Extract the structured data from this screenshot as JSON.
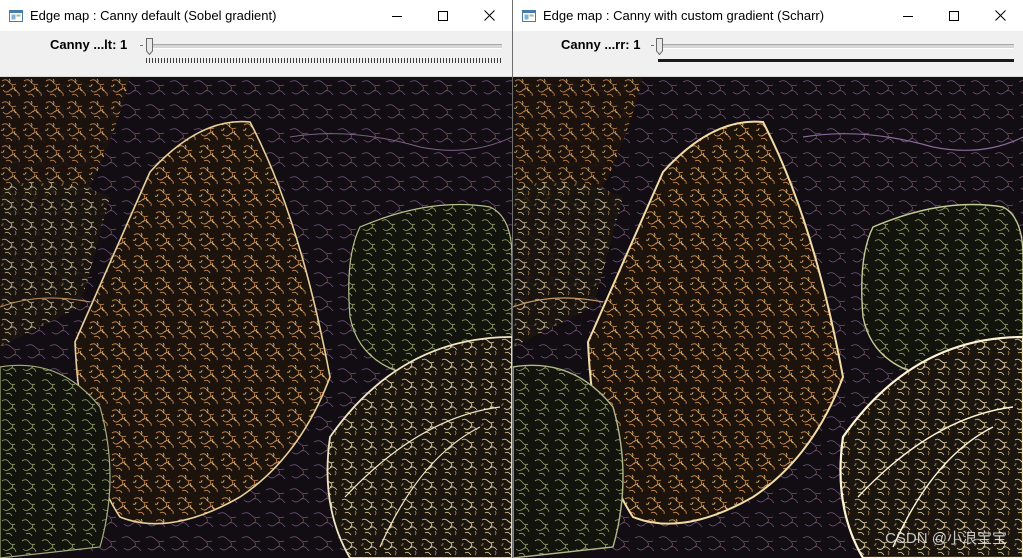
{
  "windows": [
    {
      "title": "Edge map : Canny default (Sobel gradient)",
      "trackbar": {
        "label": "Canny ...lt: 1",
        "value": 1
      },
      "icons": {
        "app": "app-window-icon",
        "minimize": "minimize-icon",
        "maximize": "maximize-icon",
        "close": "close-icon"
      }
    },
    {
      "title": "Edge map : Canny with custom gradient (Scharr)",
      "trackbar": {
        "label": "Canny ...rr: 1",
        "value": 1
      },
      "icons": {
        "app": "app-window-icon",
        "minimize": "minimize-icon",
        "maximize": "maximize-icon",
        "close": "close-icon"
      }
    }
  ],
  "watermark": "CSDN @小浪宝宝",
  "colors": {
    "titlebar": "#ffffff",
    "toolbar": "#f0f0f0",
    "image_background": "#120e0b",
    "edge_orange": "#c98a4e",
    "edge_green": "#8fa06a",
    "edge_pale": "#d8c69a",
    "edge_purple": "#6a5078"
  }
}
